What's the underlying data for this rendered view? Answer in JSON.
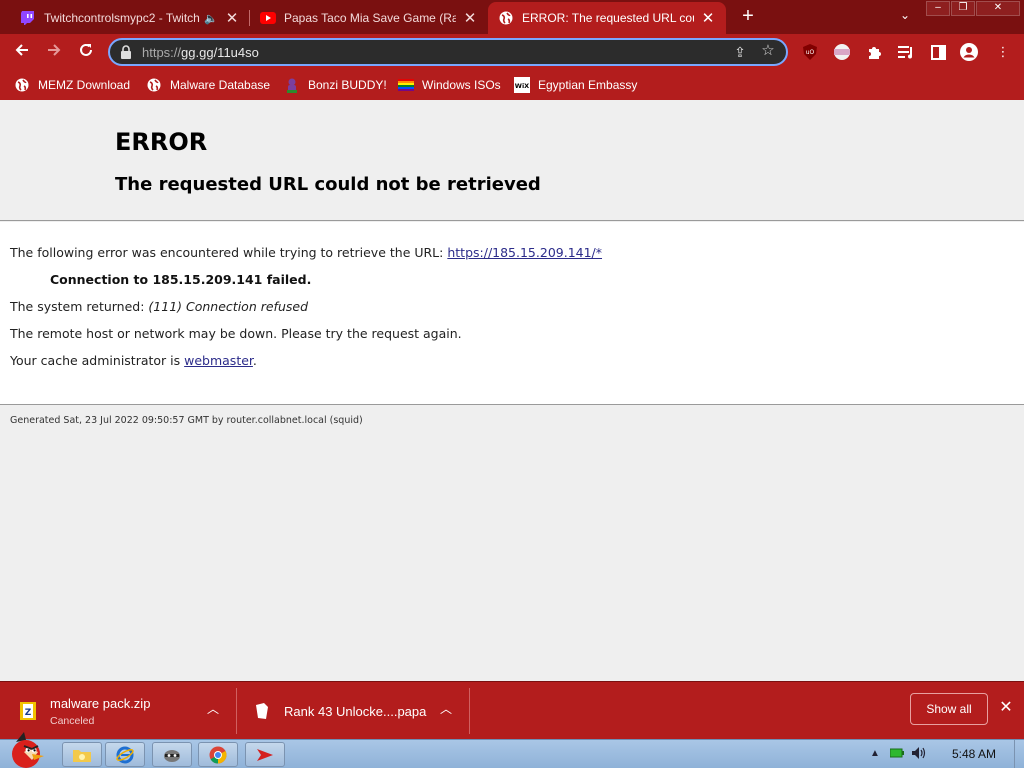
{
  "tabs": [
    {
      "title": "Twitchcontrolsmypc2 - Twitch",
      "icon": "twitch-icon"
    },
    {
      "title": "Papas Taco Mia Save Game (Rank",
      "icon": "youtube-icon"
    },
    {
      "title": "ERROR: The requested URL could not be retrieved",
      "icon": "globe-icon",
      "active": true
    }
  ],
  "toolbar": {
    "url_scheme": "https://",
    "url_host": "gg.gg/11u4so"
  },
  "bookmarks": [
    {
      "label": "MEMZ Download",
      "icon": "globe-icon"
    },
    {
      "label": "Malware Database",
      "icon": "globe-icon"
    },
    {
      "label": "Bonzi BUDDY!",
      "icon": "bonzi-icon"
    },
    {
      "label": "Windows ISOs",
      "icon": "rainbow-flag-icon"
    },
    {
      "label": "Egyptian Embassy",
      "icon": "wix-icon"
    }
  ],
  "error": {
    "title": "ERROR",
    "subtitle": "The requested URL could not be retrieved",
    "line1_text": "The following error was encountered while trying to retrieve the URL: ",
    "line1_link": "https://185.15.209.141/*",
    "line2": "Connection to 185.15.209.141 failed.",
    "line3_text": "The system returned: ",
    "line3_italic": "(111) Connection refused",
    "line4": "The remote host or network may be down. Please try the request again.",
    "line5_text": "Your cache administrator is ",
    "line5_link": "webmaster",
    "line5_end": ".",
    "generated": "Generated Sat, 23 Jul 2022 09:50:57 GMT by router.collabnet.local (squid)"
  },
  "downloads": {
    "items": [
      {
        "name": "malware pack.zip",
        "status": "Canceled"
      },
      {
        "name": "Rank 43 Unlocke....papa",
        "status": ""
      }
    ],
    "show_all": "Show all"
  },
  "taskbar": {
    "clock": "5:48 AM"
  },
  "colors": {
    "tabstrip": "#7a1010",
    "toolbar": "#b31d1d",
    "link": "#2c2c8a"
  }
}
